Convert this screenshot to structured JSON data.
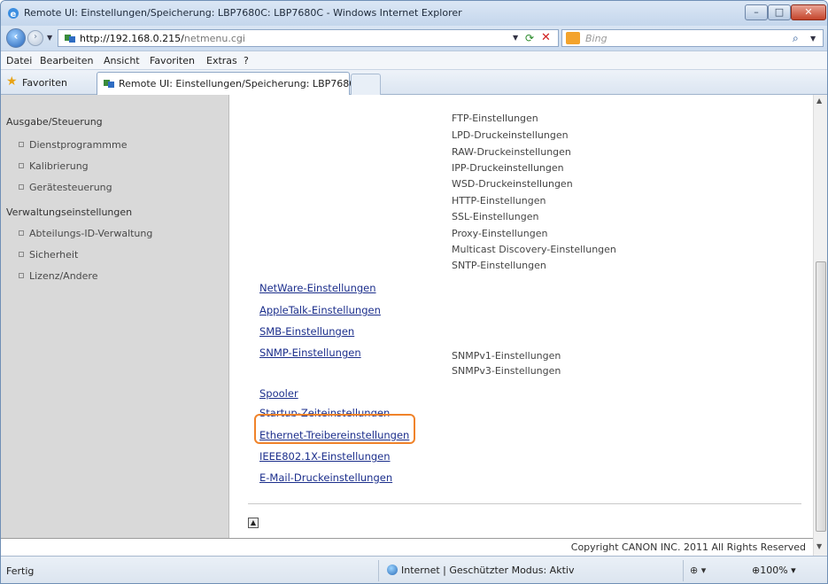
{
  "window": {
    "title": "Remote UI: Einstellungen/Speicherung: LBP7680C: LBP7680C - Windows Internet Explorer",
    "controls": {
      "minimize": "–",
      "maximize": "□",
      "close": "✕"
    }
  },
  "address": {
    "url_host": "http://192.168.0.215/",
    "url_path": "netmenu.cgi",
    "search_placeholder": "Bing"
  },
  "menubar": {
    "items": [
      "Datei",
      "Bearbeiten",
      "Ansicht",
      "Favoriten",
      "Extras",
      "?"
    ]
  },
  "favorites": {
    "label": "Favoriten",
    "tab_label": "Remote UI: Einstellungen/Speicherung: LBP7680..."
  },
  "sidebar": {
    "section1": "Ausgabe/Steuerung",
    "section1_items": [
      "Dienstprogrammme",
      "Kalibrierung",
      "Gerätesteuerung"
    ],
    "section2": "Verwaltungseinstellungen",
    "section2_items": [
      "Abteilungs-ID-Verwaltung",
      "Sicherheit",
      "Lizenz/Andere"
    ]
  },
  "main": {
    "right_links": [
      "FTP-Einstellungen",
      "LPD-Druckeinstellungen",
      "RAW-Druckeinstellungen",
      "IPP-Druckeinstellungen",
      "WSD-Druckeinstellungen",
      "HTTP-Einstellungen",
      "SSL-Einstellungen",
      "Proxy-Einstellungen",
      "Multicast Discovery-Einstellungen",
      "SNTP-Einstellungen"
    ],
    "left_links": [
      "NetWare-Einstellungen",
      "AppleTalk-Einstellungen",
      "SMB-Einstellungen",
      "SNMP-Einstellungen",
      "Spooler",
      "Startup-Zeiteinstellungen",
      "Ethernet-Treibereinstellungen",
      "IEEE802.1X-Einstellungen",
      "E-Mail-Druckeinstellungen"
    ],
    "snmp_sublinks": [
      "SNMPv1-Einstellungen",
      "SNMPv3-Einstellungen"
    ],
    "highlighted_link": "Ethernet-Treibereinstellungen",
    "highlight_color": "#f0832a",
    "copyright": "Copyright CANON INC. 2011 All Rights Reserved"
  },
  "status": {
    "text": "Fertig",
    "zone": "Internet | Geschützter Modus: Aktiv",
    "zoom": "100%"
  }
}
